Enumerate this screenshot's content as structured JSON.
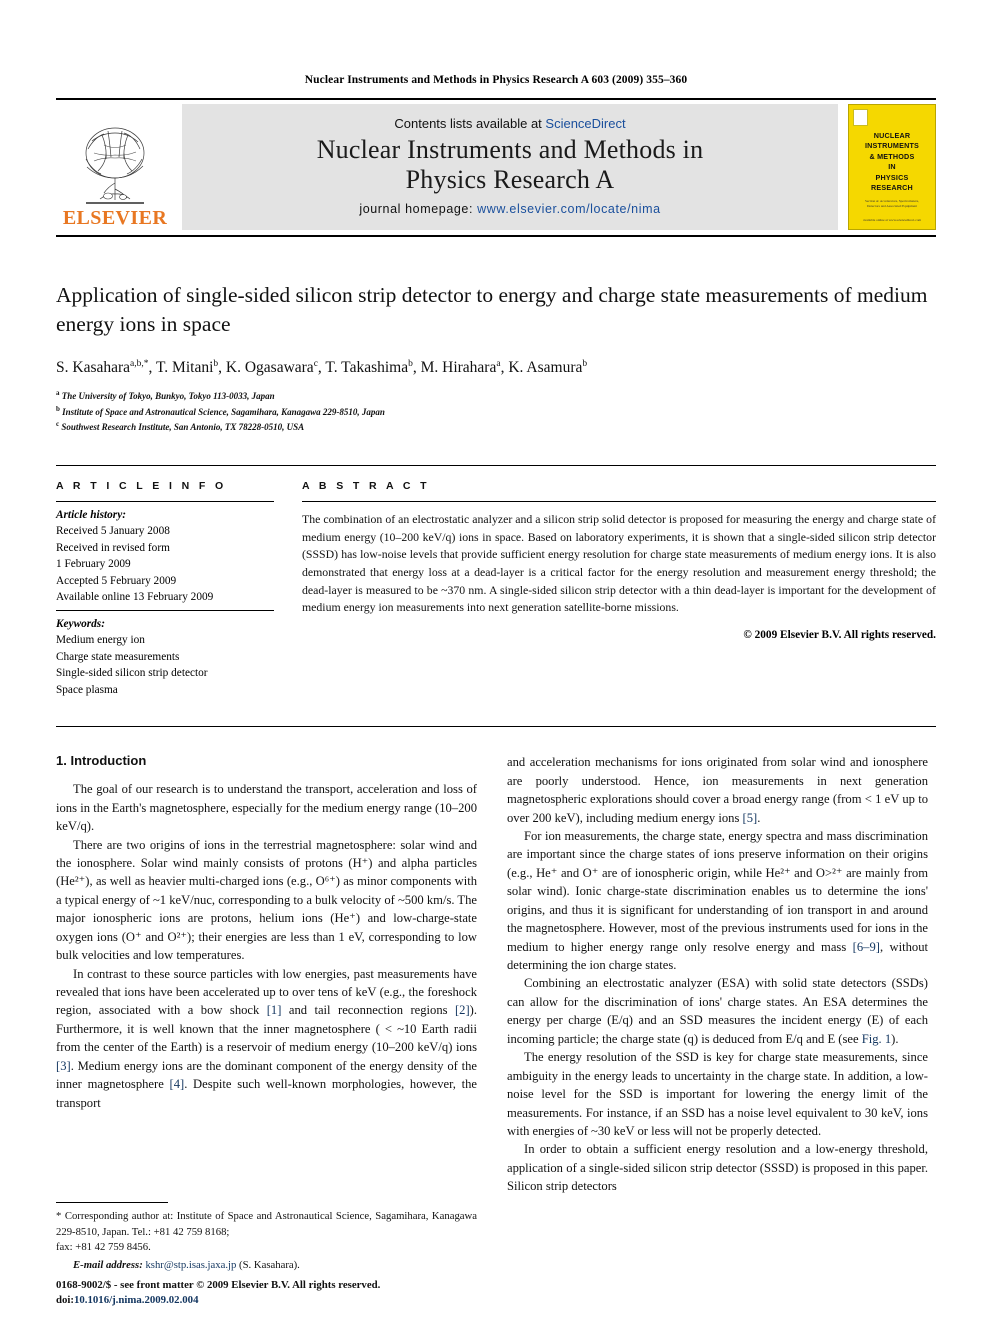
{
  "running_head": "Nuclear Instruments and Methods in Physics Research A 603 (2009) 355–360",
  "masthead": {
    "publisher": "ELSEVIER",
    "contents_prefix": "Contents lists available at ",
    "contents_link": "ScienceDirect",
    "journal_title_line1": "Nuclear Instruments and Methods in",
    "journal_title_line2": "Physics Research A",
    "homepage_prefix": "journal homepage: ",
    "homepage_url": "www.elsevier.com/locate/nima",
    "cover": {
      "title_lines": [
        "NUCLEAR",
        "INSTRUMENTS",
        "& METHODS",
        "IN",
        "PHYSICS",
        "RESEARCH"
      ],
      "subtitle": "Section A: Accelerators, Spectrometers, Detectors and Associated Equipment",
      "footer": "available online at www.sciencedirect.com"
    }
  },
  "article": {
    "title": "Application of single-sided silicon strip detector to energy and charge state measurements of medium energy ions in space",
    "authors": [
      {
        "name": "S. Kasahara",
        "marks": "a,b,*"
      },
      {
        "name": "T. Mitani",
        "marks": "b"
      },
      {
        "name": "K. Ogasawara",
        "marks": "c"
      },
      {
        "name": "T. Takashima",
        "marks": "b"
      },
      {
        "name": "M. Hirahara",
        "marks": "a"
      },
      {
        "name": "K. Asamura",
        "marks": "b"
      }
    ],
    "affiliations": [
      {
        "mark": "a",
        "text": "The University of Tokyo, Bunkyo, Tokyo 113-0033, Japan"
      },
      {
        "mark": "b",
        "text": "Institute of Space and Astronautical Science, Sagamihara, Kanagawa 229-8510, Japan"
      },
      {
        "mark": "c",
        "text": "Southwest Research Institute, San Antonio, TX 78228-0510, USA"
      }
    ]
  },
  "info": {
    "heading": "A R T I C L E   I N F O",
    "history_label": "Article history:",
    "history": [
      "Received 5 January 2008",
      "Received in revised form",
      "1 February 2009",
      "Accepted 5 February 2009",
      "Available online 13 February 2009"
    ],
    "keywords_label": "Keywords:",
    "keywords": [
      "Medium energy ion",
      "Charge state measurements",
      "Single-sided silicon strip detector",
      "Space plasma"
    ]
  },
  "abstract": {
    "heading": "A B S T R A C T",
    "text": "The combination of an electrostatic analyzer and a silicon strip solid detector is proposed for measuring the energy and charge state of medium energy (10–200 keV/q) ions in space. Based on laboratory experiments, it is shown that a single-sided silicon strip detector (SSSD) has low-noise levels that provide sufficient energy resolution for charge state measurements of medium energy ions. It is also demonstrated that energy loss at a dead-layer is a critical factor for the energy resolution and measurement energy threshold; the dead-layer is measured to be ~370 nm. A single-sided silicon strip detector with a thin dead-layer is important for the development of medium energy ion measurements into next generation satellite-borne missions.",
    "copyright": "© 2009 Elsevier B.V. All rights reserved."
  },
  "body": {
    "section_title": "1.  Introduction",
    "left_paragraphs": [
      "The goal of our research is to understand the transport, acceleration and loss of ions in the Earth's magnetosphere, especially for the medium energy range (10–200 keV/q).",
      "There are two origins of ions in the terrestrial magnetosphere: solar wind and the ionosphere. Solar wind mainly consists of protons (H⁺) and alpha particles (He²⁺), as well as heavier multi-charged ions (e.g., O⁶⁺) as minor components with a typical energy of ~1 keV/nuc, corresponding to a bulk velocity of ~500 km/s. The major ionospheric ions are protons, helium ions (He⁺) and low-charge-state oxygen ions (O⁺ and O²⁺); their energies are less than 1 eV, corresponding to low bulk velocities and low temperatures.",
      "In contrast to these source particles with low energies, past measurements have revealed that ions have been accelerated up to over tens of keV (e.g., the foreshock region, associated with a bow shock [1] and tail reconnection regions [2]). Furthermore, it is well known that the inner magnetosphere ( < ~10 Earth radii from the center of the Earth) is a reservoir of medium energy (10–200 keV/q) ions [3]. Medium energy ions are the dominant component of the energy density of the inner magnetosphere [4]. Despite such well-known morphologies, however, the transport"
    ],
    "right_paragraphs": [
      "and acceleration mechanisms for ions originated from solar wind and ionosphere are poorly understood. Hence, ion measurements in next generation magnetospheric explorations should cover a broad energy range (from < 1 eV up to over 200 keV), including medium energy ions [5].",
      "For ion measurements, the charge state, energy spectra and mass discrimination are important since the charge states of ions preserve information on their origins (e.g., He⁺ and O⁺ are of ionospheric origin, while He²⁺ and O>²⁺ are mainly from solar wind). Ionic charge-state discrimination enables us to determine the ions' origins, and thus it is significant for understanding of ion transport in and around the magnetosphere. However, most of the previous instruments used for ions in the medium to higher energy range only resolve energy and mass [6–9], without determining the ion charge states.",
      "Combining an electrostatic analyzer (ESA) with solid state detectors (SSDs) can allow for the discrimination of ions' charge states. An ESA determines the energy per charge (E/q) and an SSD measures the incident energy (E) of each incoming particle; the charge state (q) is deduced from E/q and E (see Fig. 1).",
      "The energy resolution of the SSD is key for charge state measurements, since ambiguity in the energy leads to uncertainty in the charge state. In addition, a low-noise level for the SSD is important for lowering the energy limit of the measurements. For instance, if an SSD has a noise level equivalent to 30 keV, ions with energies of ~30 keV or less will not be properly detected.",
      "In order to obtain a sufficient energy resolution and a low-energy threshold, application of a single-sided silicon strip detector (SSSD) is proposed in this paper. Silicon strip detectors"
    ]
  },
  "footnote": {
    "corresponding": "* Corresponding author at: Institute of Space and Astronautical Science, Sagamihara, Kanagawa 229-8510, Japan. Tel.: +81 42 759 8168;",
    "fax": "fax: +81 42 759 8456.",
    "email_label": "E-mail address:",
    "email": "kshr@stp.isas.jaxa.jp",
    "email_suffix": "(S. Kasahara)."
  },
  "imprint": {
    "line1": "0168-9002/$ - see front matter © 2009 Elsevier B.V. All rights reserved.",
    "doi_label": "doi:",
    "doi_value": "10.1016/j.nima.2009.02.004"
  },
  "colors": {
    "link": "#1a4f9c",
    "reference": "#12355f",
    "elsevier_orange": "#E87722",
    "cover_yellow": "#f5d800",
    "band_gray": "#e3e3e3"
  }
}
